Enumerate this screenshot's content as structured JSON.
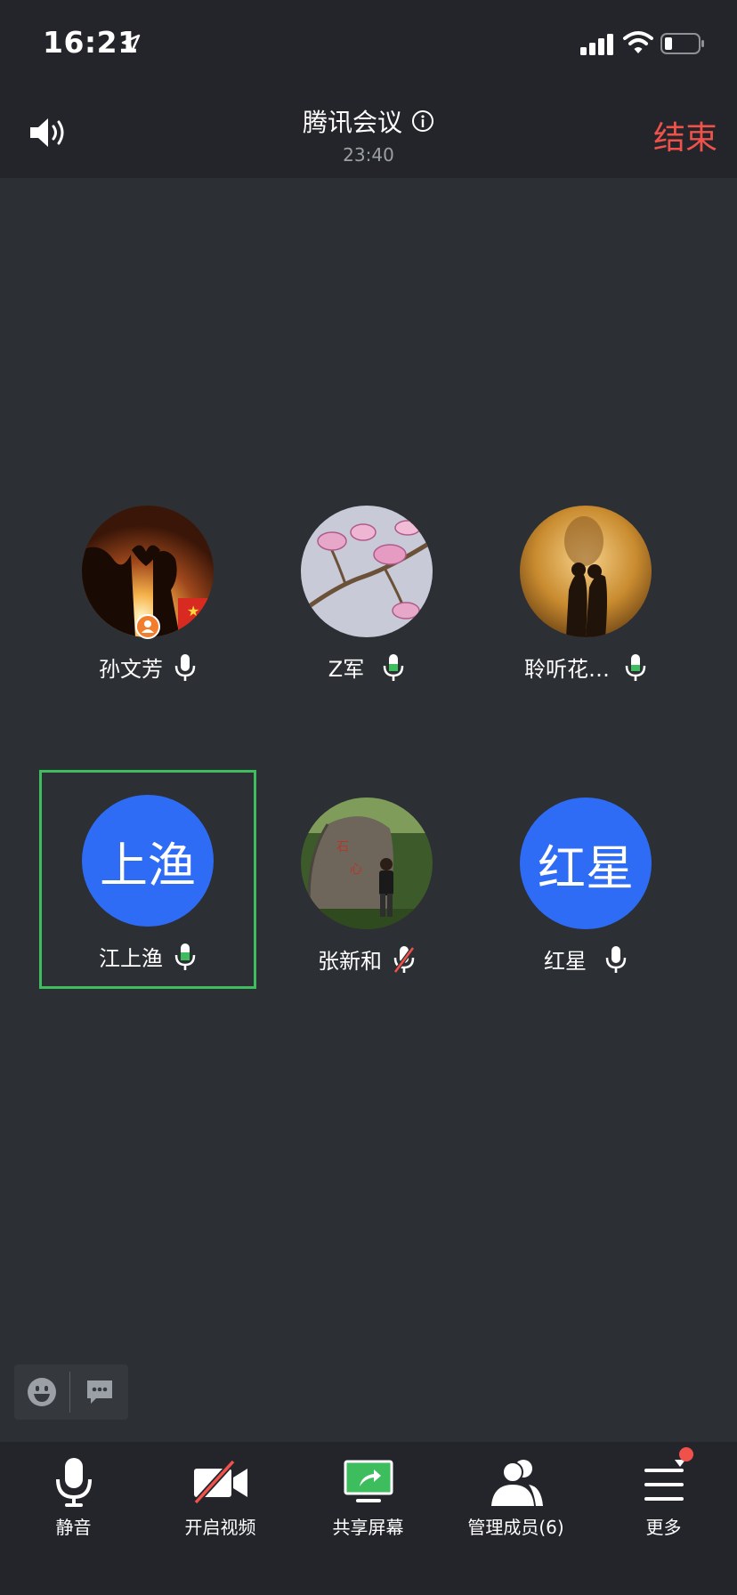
{
  "status_bar": {
    "time": "16:21"
  },
  "header": {
    "title": "腾讯会议",
    "timer": "23:40",
    "end_label": "结束"
  },
  "participants": [
    {
      "name": "孙文芳",
      "avatar": "photo",
      "mic": "on",
      "host": true
    },
    {
      "name": "Z军",
      "avatar": "photo",
      "mic": "on"
    },
    {
      "name": "聆听花…",
      "avatar": "photo",
      "mic": "on"
    },
    {
      "name": "江上渔",
      "avatar_text": "上渔",
      "mic": "on",
      "active": true
    },
    {
      "name": "张新和",
      "avatar": "photo",
      "mic": "muted"
    },
    {
      "name": "红星",
      "avatar_text": "红星",
      "mic": "on"
    }
  ],
  "toolbar": {
    "mute_label": "静音",
    "video_label": "开启视频",
    "share_label": "共享屏幕",
    "members_label": "管理成员(6)",
    "more_label": "更多"
  },
  "colors": {
    "background": "#2c2f33",
    "bar": "#23252a",
    "end_red": "#f0524b",
    "avatar_blue": "#2f6cf5",
    "active_green": "#3dbd5e",
    "speaking_green": "#3dbd5e"
  },
  "icons": [
    "location-arrow-icon",
    "signal-icon",
    "wifi-icon",
    "battery-icon",
    "speaker-icon",
    "info-icon",
    "microphone-icon",
    "muted-mic-icon",
    "host-badge-icon",
    "emoji-icon",
    "chat-icon",
    "video-off-icon",
    "share-screen-icon",
    "members-icon",
    "menu-icon"
  ]
}
